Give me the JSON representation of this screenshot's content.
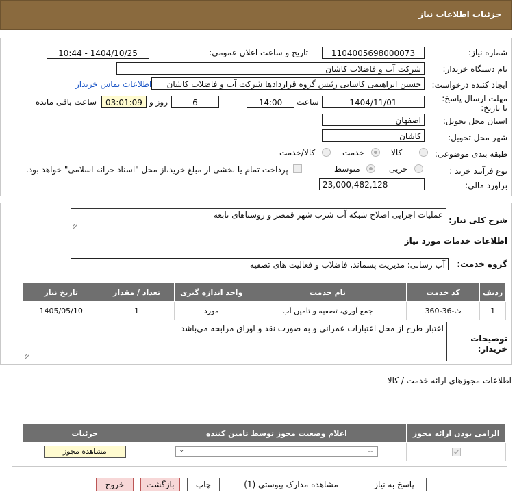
{
  "header": {
    "title": "جزئیات اطلاعات نیاز"
  },
  "need": {
    "number_label": "شماره نیاز:",
    "number": "1104005698000073",
    "announce_label": "تاریخ و ساعت اعلان عمومی:",
    "announce": "1404/10/25 - 10:44",
    "buyer_label": "نام دستگاه خریدار:",
    "buyer": "شرکت آب و فاضلاب کاشان",
    "creator_label": "ایجاد کننده درخواست:",
    "creator": "حسین ابراهیمی کاشانی رئیس گروه قراردادها شرکت آب و فاضلاب کاشان",
    "contact_link": "اطلاعات تماس خریدار",
    "deadline_label": "مهلت ارسال پاسخ: تا تاریخ:",
    "deadline_date": "1404/11/01",
    "hour_label": "ساعت",
    "deadline_time": "14:00",
    "days": "6",
    "days_label": "روز و",
    "remaining": "03:01:09",
    "remaining_label": "ساعت باقی مانده",
    "province_label": "استان محل تحویل:",
    "province": "اصفهان",
    "city_label": "شهر محل تحویل:",
    "city": "کاشان",
    "category_label": "طبقه بندی موضوعی:",
    "category_options": [
      "کالا",
      "خدمت",
      "کالا/خدمت"
    ],
    "category_selected": "خدمت",
    "process_label": "نوع فرآیند خرید :",
    "process_options": [
      "جزیی",
      "متوسط"
    ],
    "process_selected": "متوسط",
    "payment_note": "پرداخت تمام یا بخشی از مبلغ خرید،از محل \"اسناد خزانه اسلامی\" خواهد بود.",
    "budget_label": "برآورد مالی:",
    "budget": "23,000,482,128"
  },
  "summary": {
    "label": "شرح کلی نیاز:",
    "text": "عملیات اجرایی اصلاح شبکه آب شرب شهر قمصر و روستاهای تابعه"
  },
  "services": {
    "section_title": "اطلاعات خدمات مورد نیاز",
    "group_label": "گروه خدمت:",
    "group": "آب رسانی؛ مدیریت پسماند، فاضلاب و فعالیت های تصفیه",
    "columns": [
      "ردیف",
      "کد خدمت",
      "نام خدمت",
      "واحد اندازه گیری",
      "تعداد / مقدار",
      "تاریخ نیاز"
    ],
    "rows": [
      [
        "1",
        "ث-36-360",
        "جمع آوری، تصفیه و تامین آب",
        "مورد",
        "1",
        "1405/05/10"
      ]
    ]
  },
  "buyer_notes": {
    "label": "توضیحات خریدار:",
    "text": "اعتبار طرح از محل اعتبارات عمرانی و به صورت نقد و اوراق مرابحه می‌باشد"
  },
  "permits": {
    "title": "اطلاعات مجوزهای ارائه خدمت / کالا",
    "columns": [
      "الزامی بودن ارائه مجوز",
      "اعلام وضعیت مجوز توسط تامین کننده",
      "جزئیات"
    ],
    "select_value": "--",
    "view_button": "مشاهده مجوز"
  },
  "actions": {
    "reply": "پاسخ به نیاز",
    "attachments": "مشاهده مدارک پیوستی (1)",
    "print": "چاپ",
    "back": "بازگشت",
    "exit": "خروج"
  },
  "colors": {
    "header": "#8a6a3e",
    "table_header": "#6f6f6f",
    "remaining_bg": "#fffbd0",
    "link": "#1d57c7"
  }
}
